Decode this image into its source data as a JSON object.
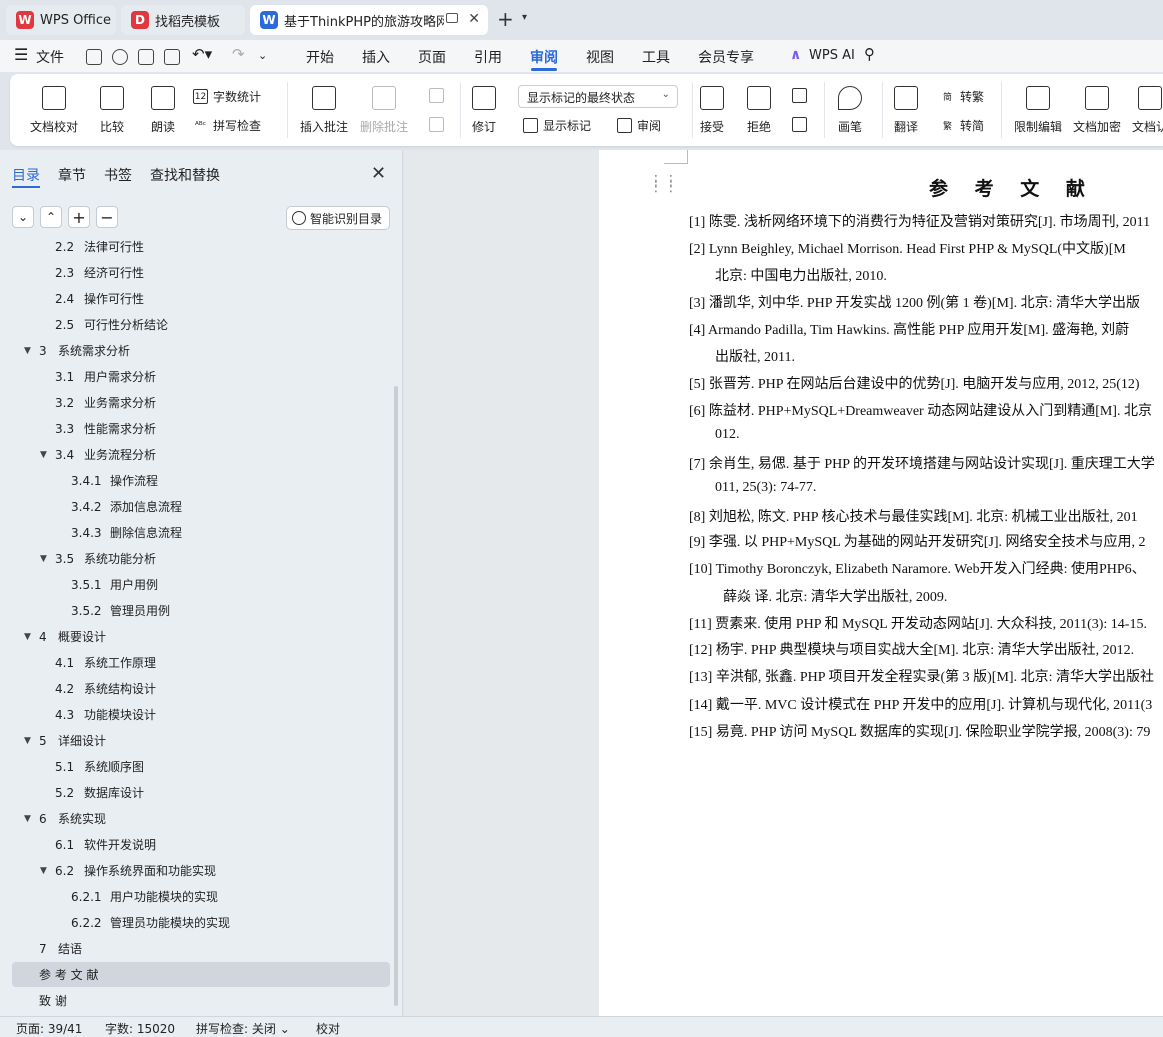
{
  "tabs": [
    {
      "label": "WPS Office",
      "icon": "wps-logo-icon",
      "color": "#e0383e"
    },
    {
      "label": "找稻壳模板",
      "icon": "docer-logo-icon",
      "color": "#e0383e"
    },
    {
      "label": "基于ThinkPHP的旅游攻略网站",
      "icon": "word-doc-icon",
      "color": "#2b6ad8"
    }
  ],
  "menu": {
    "file": "文件",
    "items": [
      "开始",
      "插入",
      "页面",
      "引用",
      "审阅",
      "视图",
      "工具",
      "会员专享"
    ],
    "active": "审阅",
    "ai": "WPS AI"
  },
  "ribbon": {
    "doc_check": "文档校对",
    "compare": "比较",
    "read_aloud": "朗读",
    "word_count": "字数统计",
    "spell_check": "拼写检查",
    "insert_comment": "插入批注",
    "delete_comment": "删除批注",
    "revise": "修订",
    "markup_state": "显示标记的最终状态",
    "show_markup": "显示标记",
    "review": "审阅",
    "accept": "接受",
    "reject": "拒绝",
    "ink": "画笔",
    "translate": "翻译",
    "to_traditional": "转繁",
    "to_simplified": "转简",
    "restrict_edit": "限制编辑",
    "doc_encrypt": "文档加密",
    "doc_auth": "文档认"
  },
  "nav": {
    "tabs": [
      "目录",
      "章节",
      "书签",
      "查找和替换"
    ],
    "smart_toc": "智能识别目录",
    "toc": [
      {
        "num": "2.2",
        "title": "法律可行性",
        "level": 2
      },
      {
        "num": "2.3",
        "title": "经济可行性",
        "level": 2
      },
      {
        "num": "2.4",
        "title": "操作可行性",
        "level": 2
      },
      {
        "num": "2.5",
        "title": "可行性分析结论",
        "level": 2
      },
      {
        "num": "3",
        "title": "系统需求分析",
        "level": 1,
        "expanded": true
      },
      {
        "num": "3.1",
        "title": "用户需求分析",
        "level": 2
      },
      {
        "num": "3.2",
        "title": "业务需求分析",
        "level": 2
      },
      {
        "num": "3.3",
        "title": "性能需求分析",
        "level": 2
      },
      {
        "num": "3.4",
        "title": "业务流程分析",
        "level": 2,
        "expanded": true
      },
      {
        "num": "3.4.1",
        "title": "操作流程",
        "level": 3
      },
      {
        "num": "3.4.2",
        "title": "添加信息流程",
        "level": 3
      },
      {
        "num": "3.4.3",
        "title": "删除信息流程",
        "level": 3
      },
      {
        "num": "3.5",
        "title": "系统功能分析",
        "level": 2,
        "expanded": true
      },
      {
        "num": "3.5.1",
        "title": "用户用例",
        "level": 3
      },
      {
        "num": "3.5.2",
        "title": "管理员用例",
        "level": 3
      },
      {
        "num": "4",
        "title": "概要设计",
        "level": 1,
        "expanded": true
      },
      {
        "num": "4.1",
        "title": "系统工作原理",
        "level": 2
      },
      {
        "num": "4.2",
        "title": "系统结构设计",
        "level": 2
      },
      {
        "num": "4.3",
        "title": "功能模块设计",
        "level": 2
      },
      {
        "num": "5",
        "title": "详细设计",
        "level": 1,
        "expanded": true
      },
      {
        "num": "5.1",
        "title": "系统顺序图",
        "level": 2
      },
      {
        "num": "5.2",
        "title": "数据库设计",
        "level": 2
      },
      {
        "num": "6",
        "title": "系统实现",
        "level": 1,
        "expanded": true
      },
      {
        "num": "6.1",
        "title": "软件开发说明",
        "level": 2
      },
      {
        "num": "6.2",
        "title": "操作系统界面和功能实现",
        "level": 2,
        "expanded": true
      },
      {
        "num": "6.2.1",
        "title": "用户功能模块的实现",
        "level": 3
      },
      {
        "num": "6.2.2",
        "title": "管理员功能模块的实现",
        "level": 3
      },
      {
        "num": "7",
        "title": "结语",
        "level": 1
      },
      {
        "num": "",
        "title": "参 考 文 献",
        "level": 1,
        "active": true
      },
      {
        "num": "",
        "title": "致          谢",
        "level": 1
      }
    ]
  },
  "document": {
    "title": "参 考 文 献",
    "refs": [
      "[1]  陈雯. 浅析网络环境下的消费行为特征及营销对策研究[J]. 市场周刊, 2011",
      "[2]  Lynn Beighley, Michael Morrison. Head First PHP & MySQL(中文版)[M",
      "北京: 中国电力出版社, 2010.",
      "[3]  潘凯华, 刘中华. PHP 开发实战 1200 例(第 1 卷)[M]. 北京: 清华大学出版",
      "[4]  Armando Padilla, Tim Hawkins. 高性能 PHP 应用开发[M]. 盛海艳, 刘蔚",
      "出版社, 2011.",
      "[5]  张晋芳. PHP 在网站后台建设中的优势[J]. 电脑开发与应用, 2012, 25(12)",
      "[6]  陈益材. PHP+MySQL+Dreamweaver 动态网站建设从入门到精通[M]. 北京",
      "012.",
      "[7]  余肖生, 易偲. 基于 PHP 的开发环境搭建与网站设计实现[J]. 重庆理工大学",
      "011, 25(3): 74-77.",
      "[8]  刘旭松, 陈文. PHP 核心技术与最佳实践[M]. 北京: 机械工业出版社, 201",
      "[9]  李强. 以 PHP+MySQL 为基础的网站开发研究[J]. 网络安全技术与应用, 2",
      "[10] Timothy Boronczyk, Elizabeth Naramore. Web开发入门经典: 使用PHP6、",
      "薛焱 译. 北京: 清华大学出版社, 2009.",
      "[11] 贾素来. 使用 PHP 和 MySQL 开发动态网站[J]. 大众科技, 2011(3): 14-15.",
      "[12] 杨宇. PHP 典型模块与项目实战大全[M]. 北京: 清华大学出版社, 2012.",
      "[13] 辛洪郁, 张鑫. PHP 项目开发全程实录(第 3 版)[M]. 北京: 清华大学出版社",
      "[14] 戴一平. MVC 设计模式在 PHP 开发中的应用[J]. 计算机与现代化, 2011(3",
      "[15] 易竟. PHP 访问 MySQL 数据库的实现[J]. 保险职业学院学报, 2008(3): 79"
    ]
  },
  "status": {
    "page": "页面: 39/41",
    "words": "字数: 15020",
    "spell": "拼写检查: 关闭",
    "proof": "校对"
  },
  "colors": {
    "accent": "#2b6ad8"
  }
}
